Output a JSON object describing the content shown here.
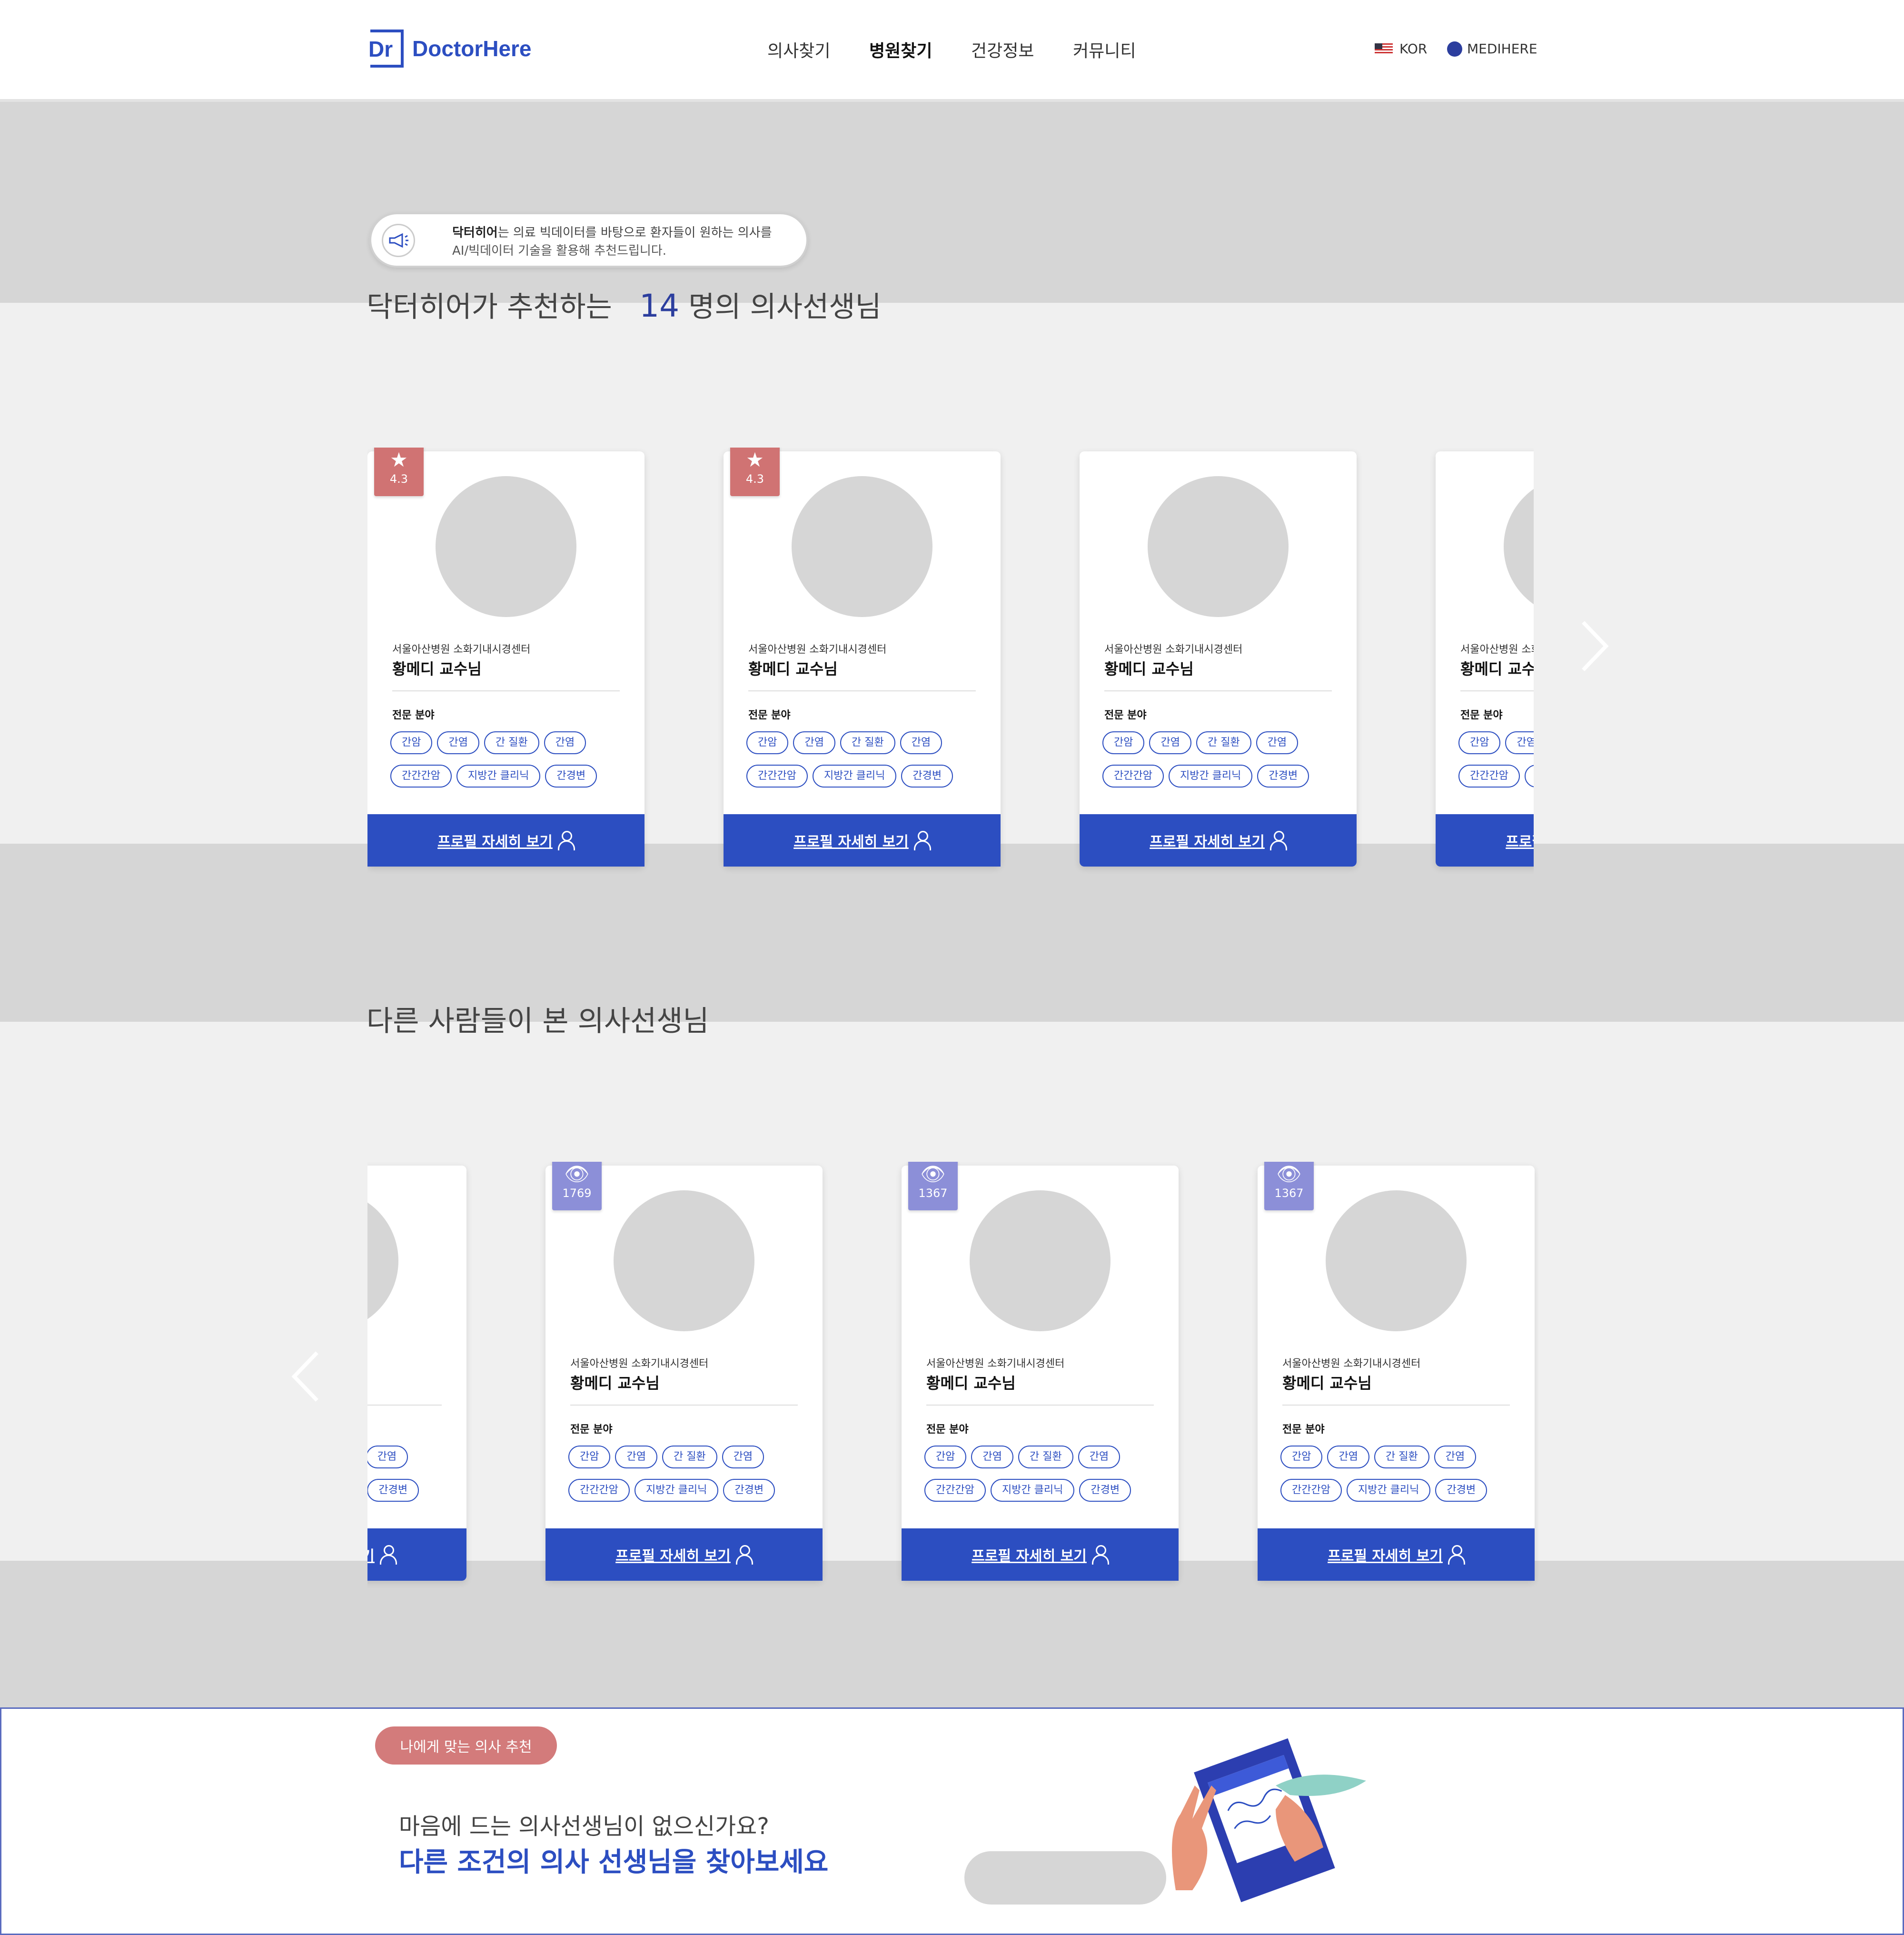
{
  "header": {
    "logo_mark": "Dr",
    "logo_text": "DoctorHere",
    "nav": [
      "의사찾기",
      "병원찾기",
      "건강정보",
      "커뮤니티"
    ],
    "active_nav": "병원찾기",
    "language": "KOR",
    "brand": "MEDIHERE"
  },
  "notice": {
    "bold": "닥터히어",
    "line1_rest": "는 의료 빅데이터를 바탕으로 환자들이 원하는 의사를",
    "line2": "AI/빅데이터 기술을 활용해 추천드립니다."
  },
  "recommended": {
    "title_prefix": "닥터히어가 추천하는",
    "count": "14",
    "title_suffix": "명의 의사선생님"
  },
  "viewed": {
    "title": "다른 사람들이 본 의사선생님"
  },
  "card_common": {
    "hospital": "서울아산병원 소화기내시경센터",
    "name": "황메디 교수님",
    "specialty_label": "전문 분야",
    "tags": [
      "간암",
      "간염",
      "간 질환",
      "간염",
      "간간간암",
      "지방간 클리닉",
      "간경변"
    ],
    "cta": "프로필 자세히 보기"
  },
  "recommended_cards": [
    {
      "badge_type": "star",
      "badge_value": "4.3"
    },
    {
      "badge_type": "star",
      "badge_value": "4.3"
    },
    {
      "badge_type": "none",
      "badge_value": ""
    },
    {
      "badge_type": "none",
      "badge_value": "",
      "partial": true
    }
  ],
  "viewed_cards": [
    {
      "badge_type": "none",
      "badge_value": "",
      "partial": true
    },
    {
      "badge_type": "eye",
      "badge_value": "1769"
    },
    {
      "badge_type": "eye",
      "badge_value": "1367"
    },
    {
      "badge_type": "eye",
      "badge_value": "1367"
    }
  ],
  "bottom": {
    "pill": "나에게 맞는 의사 추천",
    "question": "마음에 드는 의사선생님이 없으신가요?",
    "headline": "다른 조건의 의사 선생님을 찾아보세요"
  },
  "colors": {
    "primary": "#2c4ec1",
    "star_badge": "#d07373",
    "eye_badge": "#8c8fd8",
    "pill": "#d37b7b",
    "band": "#d6d6d6"
  }
}
